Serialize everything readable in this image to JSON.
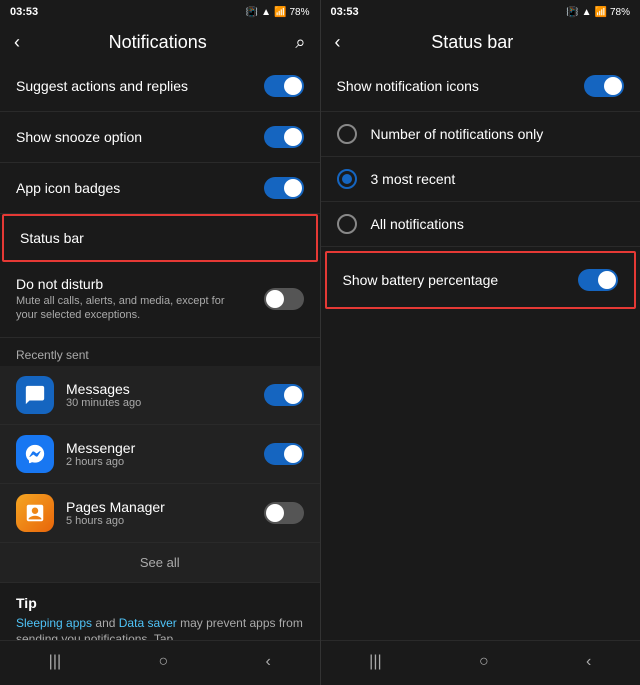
{
  "left": {
    "statusBar": {
      "time": "03:53",
      "icons": "🔕 ▲ 78%"
    },
    "nav": {
      "back": "‹",
      "title": "Notifications",
      "search": "⌕"
    },
    "settings": [
      {
        "id": "suggest",
        "label": "Suggest actions and replies",
        "toggle": "on",
        "highlighted": false
      },
      {
        "id": "snooze",
        "label": "Show snooze option",
        "toggle": "on",
        "highlighted": false
      },
      {
        "id": "badges",
        "label": "App icon badges",
        "toggle": "on",
        "highlighted": false
      },
      {
        "id": "statusbar",
        "label": "Status bar",
        "toggle": null,
        "highlighted": true
      },
      {
        "id": "dnd",
        "label": "Do not disturb",
        "sub": "Mute all calls, alerts, and media, except for your selected exceptions.",
        "toggle": "off",
        "highlighted": false
      }
    ],
    "recentlySent": {
      "label": "Recently sent",
      "apps": [
        {
          "id": "messages",
          "name": "Messages",
          "time": "30 minutes ago",
          "toggle": "on",
          "icon": "💬",
          "iconClass": "messages"
        },
        {
          "id": "messenger",
          "name": "Messenger",
          "time": "2 hours ago",
          "toggle": "on",
          "icon": "💬",
          "iconClass": "messenger"
        },
        {
          "id": "pages",
          "name": "Pages Manager",
          "time": "5 hours ago",
          "toggle": "off",
          "icon": "📄",
          "iconClass": "pages"
        }
      ],
      "seeAll": "See all"
    },
    "tip": {
      "title": "Tip",
      "text1": "Sleeping apps",
      "text2": " and ",
      "text3": "Data saver",
      "text4": " may prevent apps from sending you notifications. Tap..."
    },
    "bottomNav": [
      "|||",
      "○",
      "‹"
    ]
  },
  "right": {
    "statusBar": {
      "time": "03:53",
      "icons": "🔕 ▲ 78%"
    },
    "nav": {
      "back": "‹",
      "title": "Status bar"
    },
    "settings": [
      {
        "id": "notif-icons",
        "label": "Show notification icons",
        "toggle": "on"
      }
    ],
    "radioOptions": [
      {
        "id": "number-only",
        "label": "Number of notifications only",
        "selected": false
      },
      {
        "id": "three-recent",
        "label": "3 most recent",
        "selected": true
      },
      {
        "id": "all-notif",
        "label": "All notifications",
        "selected": false
      }
    ],
    "showBattery": {
      "label": "Show battery percentage",
      "toggle": "on"
    },
    "bottomNav": [
      "|||",
      "○",
      "‹"
    ]
  }
}
